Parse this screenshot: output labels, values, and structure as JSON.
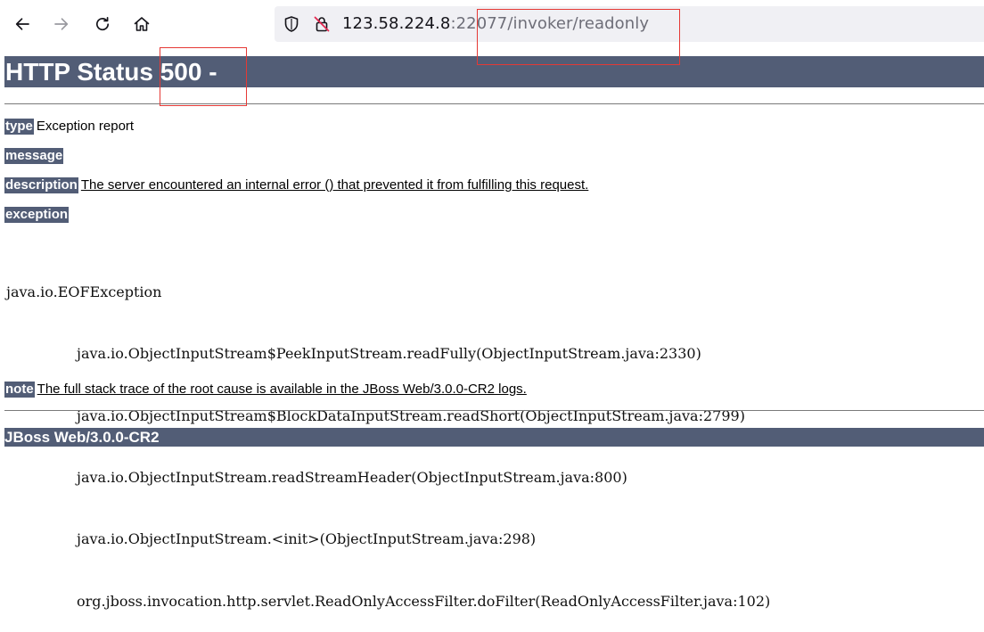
{
  "browser": {
    "url_host": "123.58.224.8",
    "url_rest": ":22077/invoker/readonly"
  },
  "page": {
    "heading": "HTTP Status 500 -",
    "type_label": "type",
    "type_value": "Exception report",
    "message_label": "message",
    "message_value": "",
    "description_label": "description",
    "description_value": "The server encountered an internal error () that prevented it from fulfilling this request.",
    "exception_label": "exception",
    "stack_trace": [
      "java.io.EOFException",
      "java.io.ObjectInputStream$PeekInputStream.readFully(ObjectInputStream.java:2330)",
      "java.io.ObjectInputStream$BlockDataInputStream.readShort(ObjectInputStream.java:2799)",
      "java.io.ObjectInputStream.readStreamHeader(ObjectInputStream.java:800)",
      "java.io.ObjectInputStream.<init>(ObjectInputStream.java:298)",
      "org.jboss.invocation.http.servlet.ReadOnlyAccessFilter.doFilter(ReadOnlyAccessFilter.java:102)"
    ],
    "note_label": "note",
    "note_value": "The full stack trace of the root cause is available in the JBoss Web/3.0.0-CR2 logs.",
    "footer": "JBoss Web/3.0.0-CR2"
  },
  "colors": {
    "tomcat_bar": "#525d76",
    "annotation": "#e53935",
    "urlbar_bg": "#f0f0f4"
  },
  "icons": [
    "back-arrow-icon",
    "forward-arrow-icon",
    "reload-icon",
    "home-icon",
    "shield-icon",
    "insecure-lock-icon"
  ]
}
